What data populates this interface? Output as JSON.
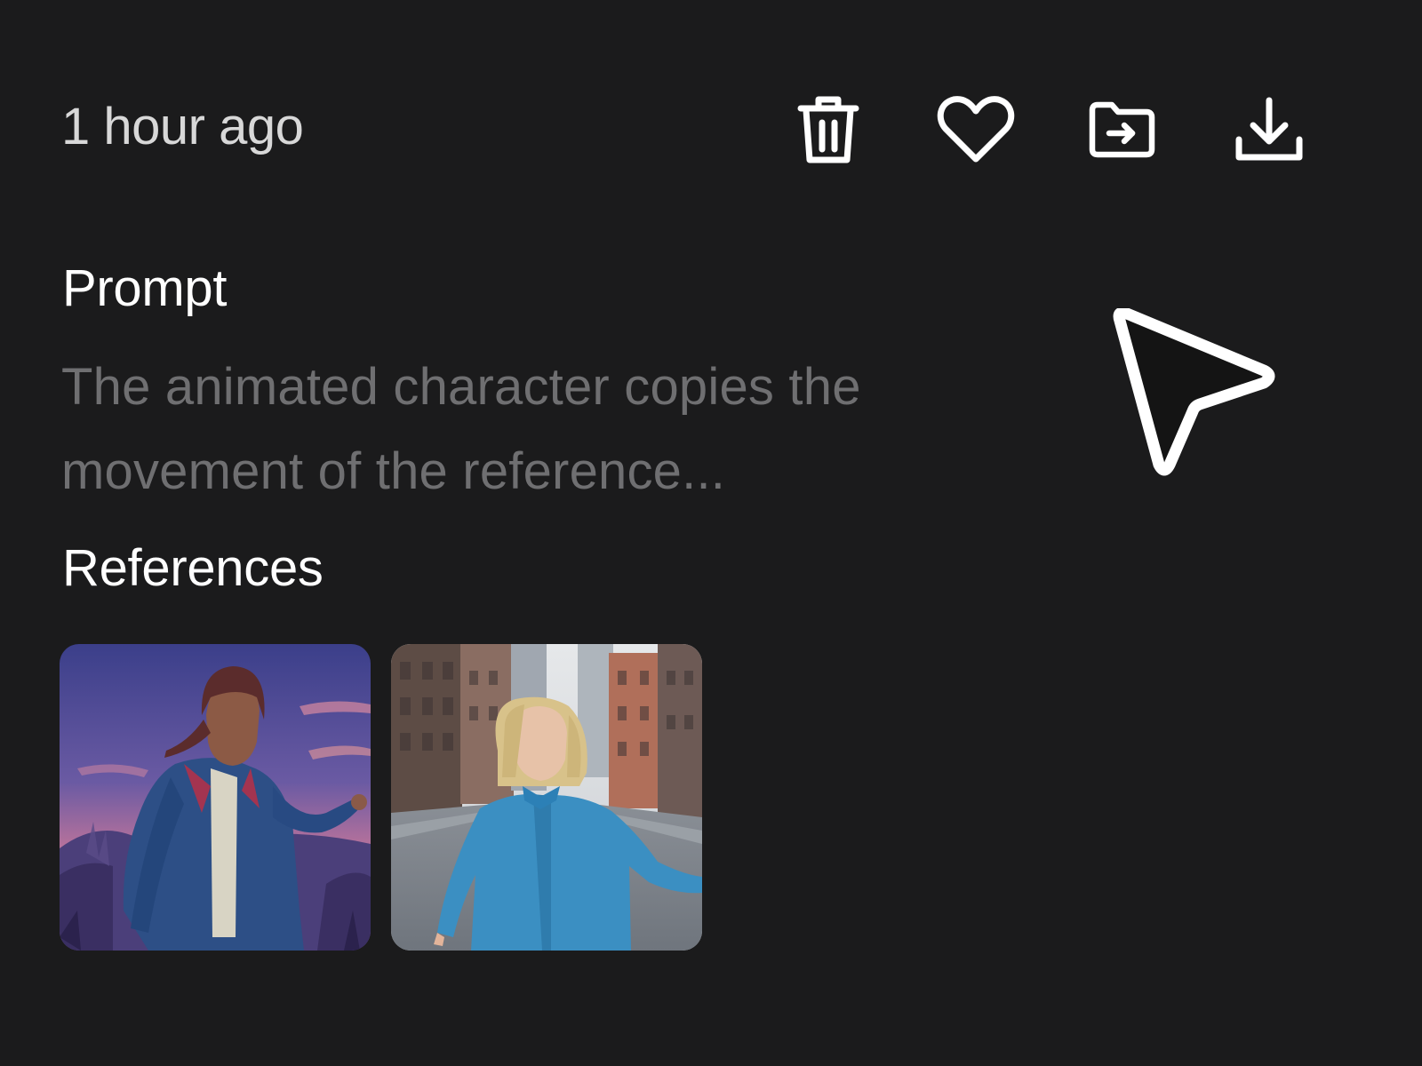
{
  "header": {
    "timestamp": "1 hour ago",
    "actions": [
      {
        "name": "delete",
        "icon": "trash-icon"
      },
      {
        "name": "favorite",
        "icon": "heart-icon"
      },
      {
        "name": "move-to-folder",
        "icon": "folder-move-icon"
      },
      {
        "name": "download",
        "icon": "download-icon"
      }
    ]
  },
  "prompt": {
    "title": "Prompt",
    "text": "The animated character copies the movement of the reference..."
  },
  "references": {
    "title": "References",
    "items": [
      {
        "kind": "animated-character-image"
      },
      {
        "kind": "live-action-reference-image"
      }
    ]
  },
  "colors": {
    "background": "#1b1b1c",
    "primary_text": "#ffffff",
    "secondary_text": "#d8d8d8",
    "muted_text": "#6f6f71"
  }
}
